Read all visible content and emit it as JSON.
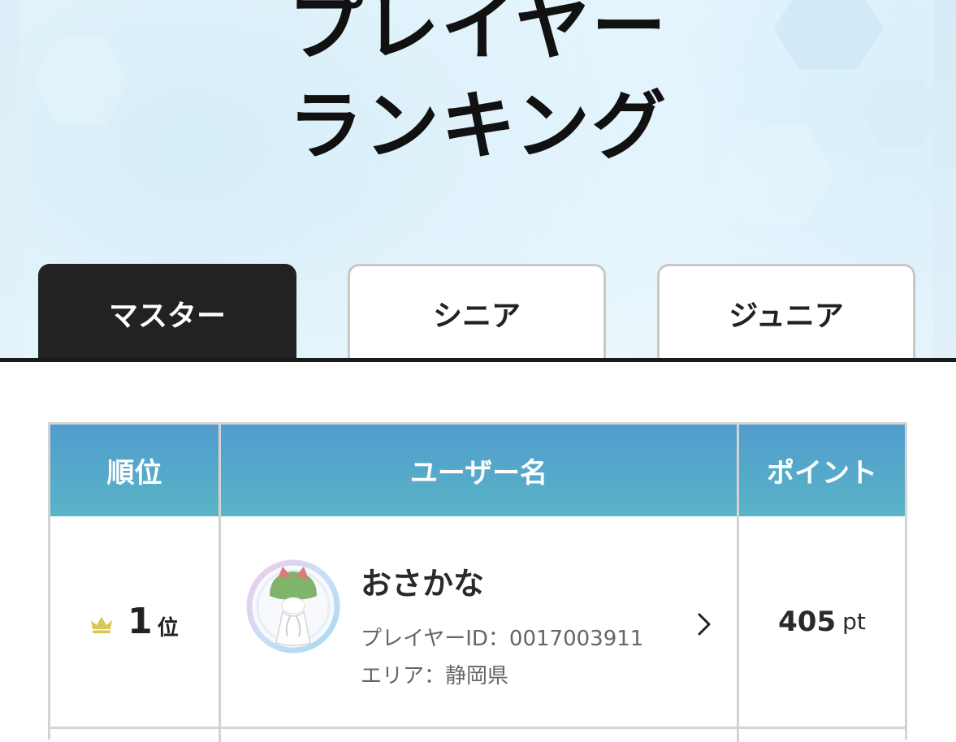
{
  "page": {
    "title_line1": "プレイヤー",
    "title_line2": "ランキング"
  },
  "tabs": [
    {
      "label": "マスター",
      "active": true
    },
    {
      "label": "シニア",
      "active": false
    },
    {
      "label": "ジュニア",
      "active": false
    }
  ],
  "table": {
    "headers": {
      "rank": "順位",
      "user": "ユーザー名",
      "points": "ポイント"
    },
    "rows": [
      {
        "rank": "1",
        "rank_suffix": "位",
        "rank_icon": "crown-icon",
        "name": "おさかな",
        "player_id": "プレイヤーID：0017003911",
        "area": "エリア：静岡県",
        "points": "405",
        "points_unit": "pt"
      }
    ]
  },
  "colors": {
    "header_gradient_top": "#519ccd",
    "header_gradient_bottom": "#5ab4c6",
    "active_tab": "#222222",
    "crown": "#d8c657"
  }
}
